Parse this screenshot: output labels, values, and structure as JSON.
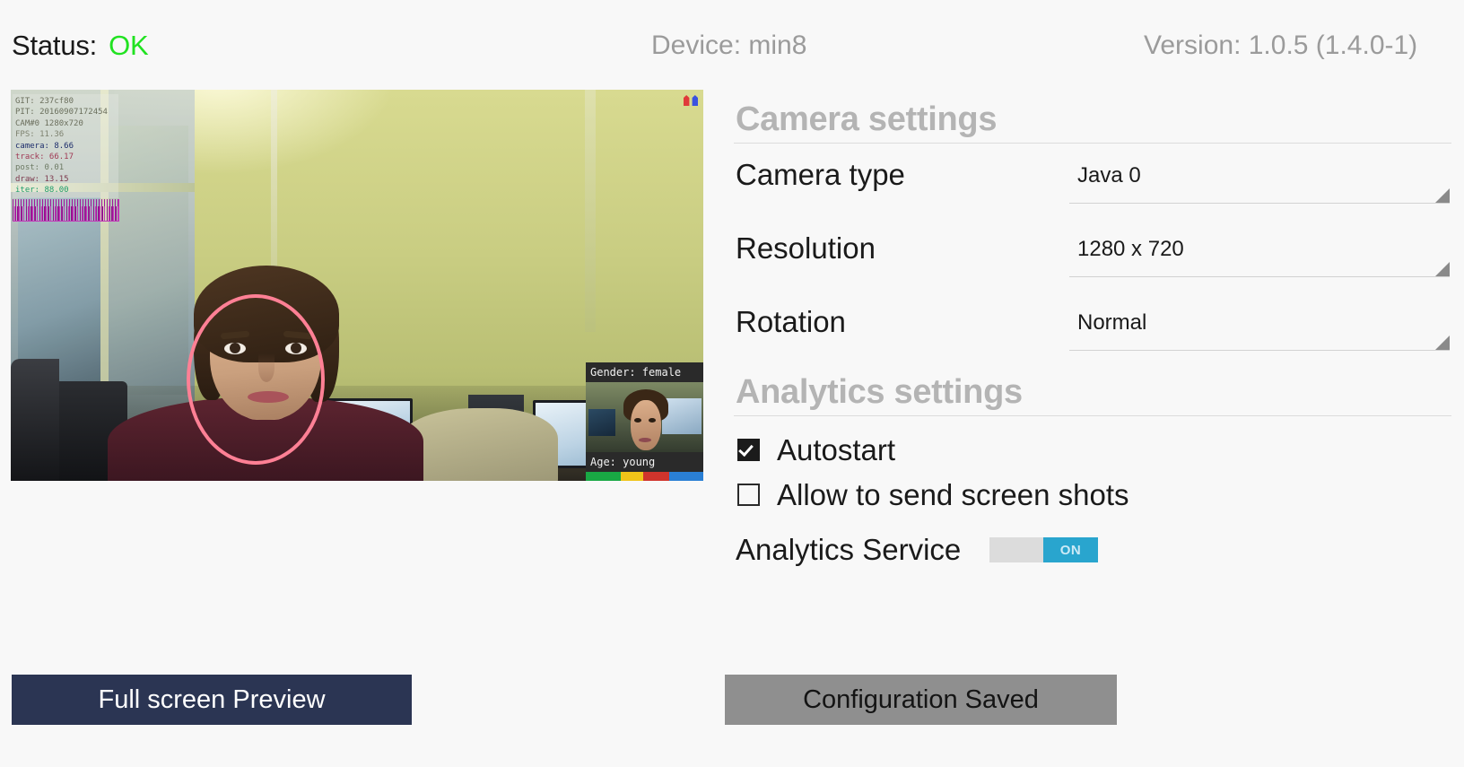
{
  "header": {
    "status_label": "Status:",
    "status_value": "OK",
    "status_color": "#21e221",
    "device": "Device: min8",
    "version": "Version: 1.0.5 (1.4.0-1)"
  },
  "preview": {
    "overlay": {
      "git": "GIT: 237cf80",
      "pit": "PIT: 20160907172454",
      "cam": "CAM#0 1280x720",
      "fps": "FPS: 11.36",
      "camera": "camera: 8.66",
      "track": "track: 66.17",
      "post": "post: 0.01",
      "draw": "draw: 13.15",
      "iter": "iter: 88.00"
    },
    "face_panel": {
      "gender": "Gender: female",
      "age": "Age: young",
      "bar_colors": [
        "#19a844",
        "#f0c419",
        "#d0342c",
        "#2a7fd4"
      ]
    },
    "tracker_color": "#ff8095"
  },
  "camera_settings": {
    "title": "Camera settings",
    "rows": [
      {
        "label": "Camera type",
        "value": "Java  0"
      },
      {
        "label": "Resolution",
        "value": "1280 x 720"
      },
      {
        "label": "Rotation",
        "value": "Normal"
      }
    ]
  },
  "analytics_settings": {
    "title": "Analytics settings",
    "autostart": {
      "label": "Autostart",
      "checked": "true"
    },
    "screenshots": {
      "label": "Allow to send screen shots",
      "checked": "false"
    },
    "service": {
      "label": "Analytics Service",
      "state": "ON",
      "on_color": "#29a5ce"
    }
  },
  "buttons": {
    "preview": "Full screen Preview",
    "save": "Configuration Saved"
  }
}
